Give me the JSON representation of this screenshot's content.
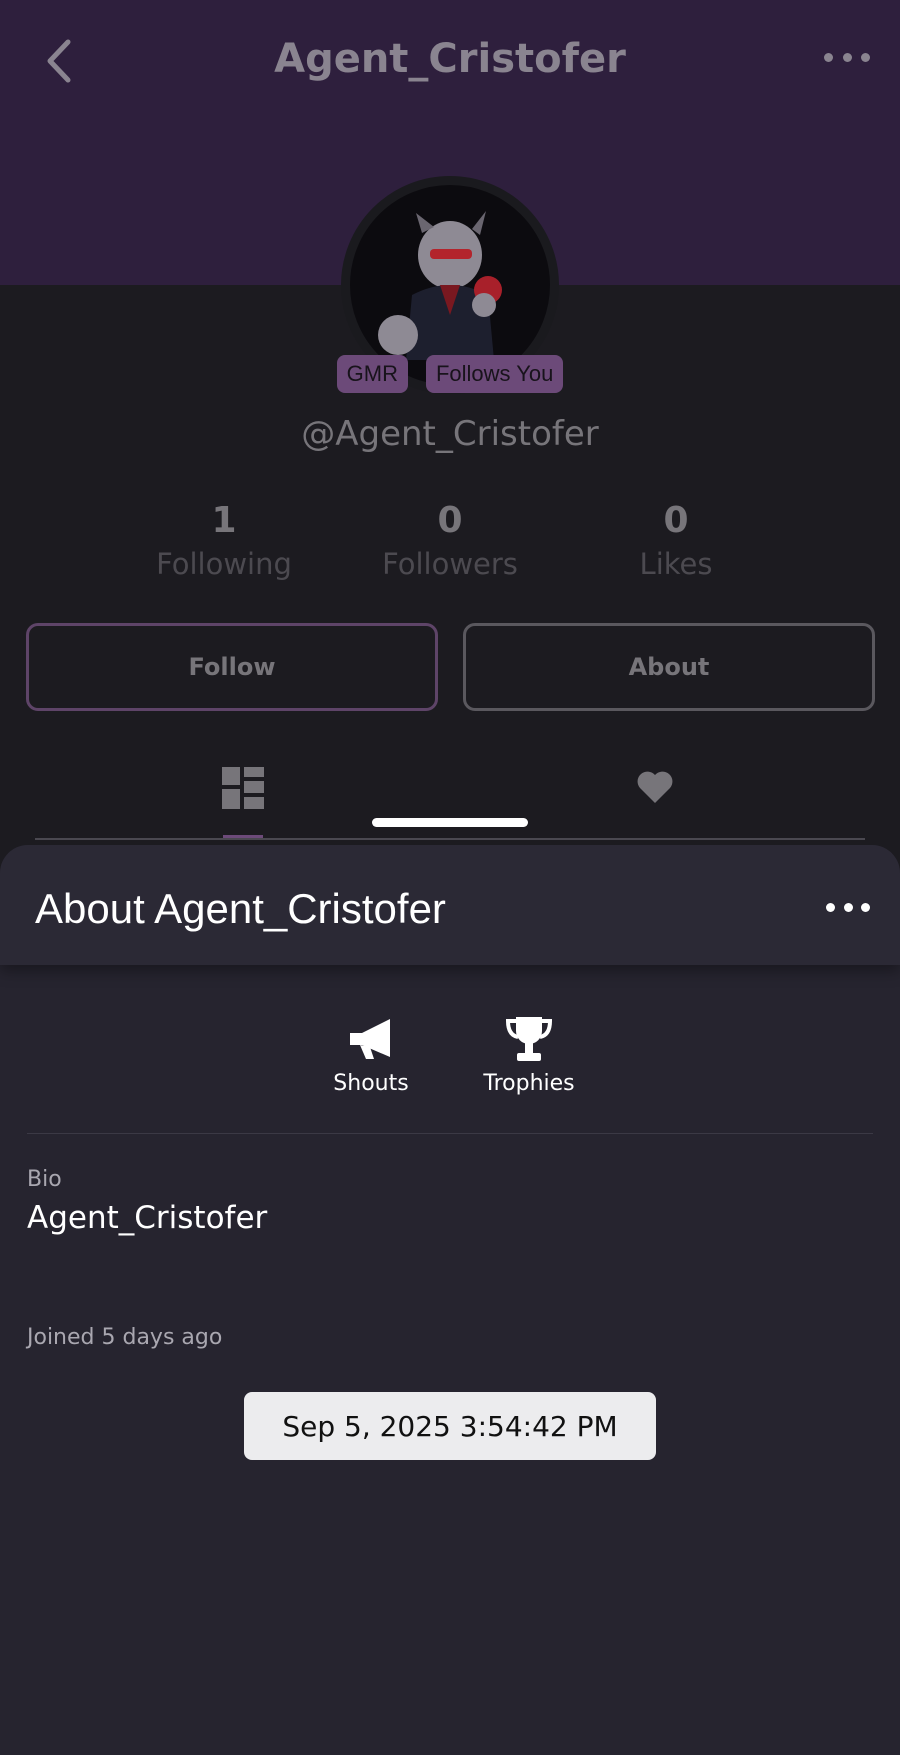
{
  "header": {
    "title": "Agent_Cristofer"
  },
  "profile": {
    "badges": [
      "GMR",
      "Follows You"
    ],
    "handle": "@Agent_Cristofer",
    "stats": [
      {
        "value": "1",
        "label": "Following"
      },
      {
        "value": "0",
        "label": "Followers"
      },
      {
        "value": "0",
        "label": "Likes"
      }
    ],
    "follow_label": "Follow",
    "about_label": "About"
  },
  "sheet": {
    "title": "About Agent_Cristofer",
    "actions": [
      {
        "label": "Shouts",
        "icon": "megaphone-icon"
      },
      {
        "label": "Trophies",
        "icon": "trophy-icon"
      }
    ],
    "bio_label": "Bio",
    "bio_value": "Agent_Cristofer",
    "joined": "Joined 5 days ago",
    "joined_tooltip": "Sep 5, 2025 3:54:42 PM"
  },
  "colors": {
    "banner": "#2e1f3d",
    "accent": "#6c4a79",
    "sheet": "#26242f"
  }
}
